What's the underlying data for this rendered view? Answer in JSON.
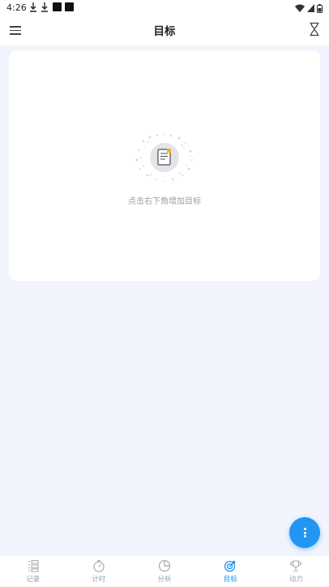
{
  "status_bar": {
    "time": "4:26"
  },
  "app_bar": {
    "title": "目标",
    "menu_icon": "menu-icon",
    "timer_icon": "hourglass-icon"
  },
  "empty_state": {
    "message": "点击右下角增加目标",
    "icon": "empty-document-icon"
  },
  "fab": {
    "icon": "more-vertical-icon"
  },
  "bottom_nav": {
    "active_index": 3,
    "active_color": "#2196f3",
    "items": [
      {
        "label": "记录",
        "icon": "records-list-icon"
      },
      {
        "label": "计时",
        "icon": "stopwatch-icon"
      },
      {
        "label": "分析",
        "icon": "pie-chart-icon"
      },
      {
        "label": "目标",
        "icon": "target-icon"
      },
      {
        "label": "动力",
        "icon": "trophy-icon"
      }
    ]
  },
  "colors": {
    "accent": "#2196f3",
    "background": "#f1f4fd",
    "card": "#ffffff"
  }
}
